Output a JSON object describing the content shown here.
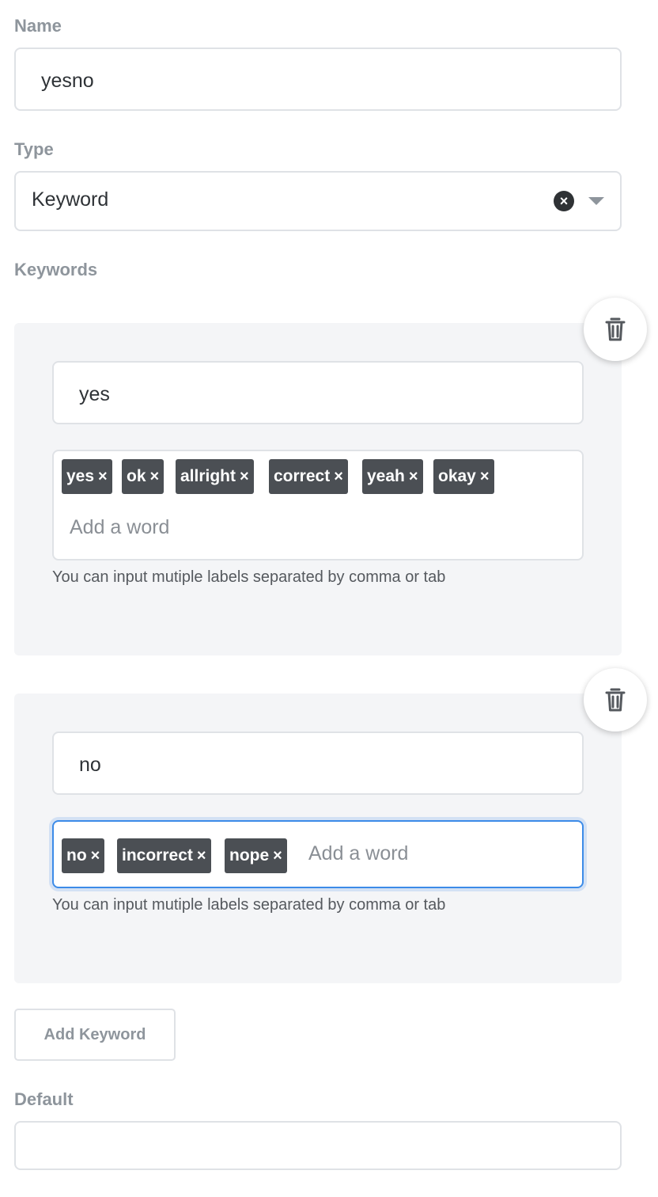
{
  "name": {
    "label": "Name",
    "value": "yesno"
  },
  "type": {
    "label": "Type",
    "selected": "Keyword"
  },
  "keywords": {
    "label": "Keywords",
    "help_text": "You can input mutiple labels separated by comma or tab",
    "add_word_placeholder": "Add a word",
    "groups": [
      {
        "name": "yes",
        "words": [
          "yes",
          "ok",
          "allright",
          "correct",
          "yeah",
          "okay"
        ]
      },
      {
        "name": "no",
        "words": [
          "no",
          "incorrect",
          "nope"
        ]
      }
    ],
    "add_button": "Add Keyword"
  },
  "default": {
    "label": "Default",
    "value": ""
  },
  "colors": {
    "tag_bg": "#4b4f54",
    "focus": "#3c8be8",
    "panel_bg": "#f4f5f7",
    "label": "#8e959c"
  },
  "icons": {
    "trash": "trash-icon",
    "clear": "clear-icon",
    "dropdown": "chevron-down-icon",
    "tag_remove": "close-icon"
  }
}
